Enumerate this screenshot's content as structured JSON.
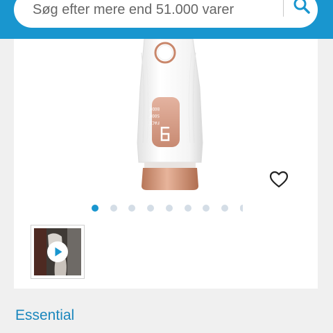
{
  "search": {
    "placeholder": "Søg efter mere end 51.000 varer",
    "icon": "search-icon"
  },
  "product": {
    "image": "ipl-hair-removal-device",
    "device_display": {
      "digit": "6",
      "labels": [
        "BODY",
        "SOOY",
        "FACE"
      ]
    },
    "favorite_icon": "heart-outline-icon",
    "brand": "Essential"
  },
  "gallery": {
    "dots_total": 9,
    "active_index": 0,
    "thumbnail": {
      "type": "video",
      "icon": "play-icon"
    }
  },
  "colors": {
    "header": "#1996cf",
    "accent": "#1996cf",
    "brand_text": "#1b87bd",
    "device_accent": "#c9876b"
  }
}
